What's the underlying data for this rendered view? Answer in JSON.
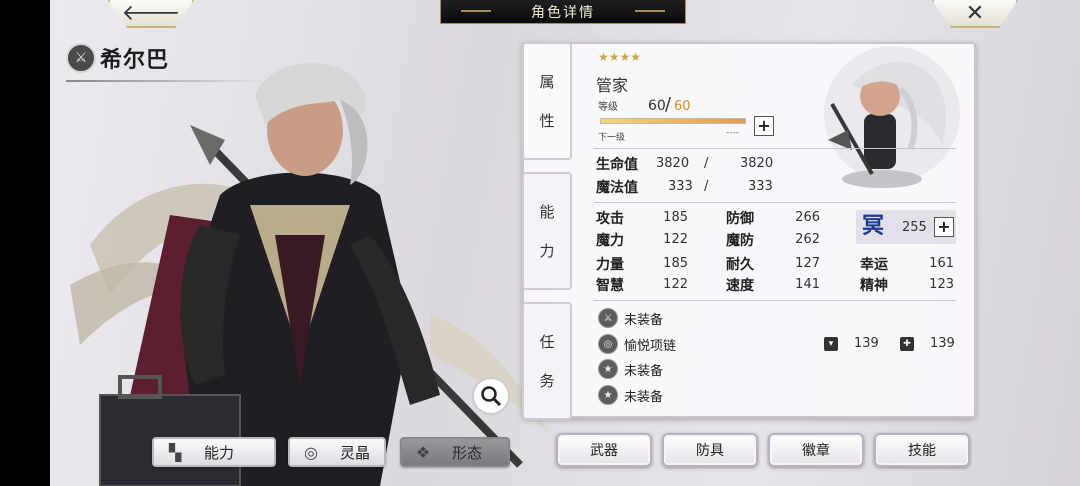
{
  "header": {
    "title": "角色详情",
    "back_icon": "arrow-left-icon",
    "close_icon": "close-icon"
  },
  "character": {
    "name": "希尔巴",
    "stars": "★★★★",
    "star_count": 4,
    "class": "管家"
  },
  "tabs": [
    {
      "label_1": "属",
      "label_2": "性"
    },
    {
      "label_1": "能",
      "label_2": "力"
    },
    {
      "label_1": "任",
      "label_2": "务"
    }
  ],
  "level": {
    "label": "等级",
    "current": "60",
    "slash": "/",
    "max": "60",
    "next_label": "下一级",
    "next_value": "----",
    "progress": 1.0
  },
  "vitals": {
    "hp_label": "生命值",
    "hp_current": "3820",
    "hp_max": "3820",
    "mp_label": "魔法值",
    "mp_current": "333",
    "mp_max": "333",
    "slash": "/"
  },
  "stats": {
    "atk_label": "攻击",
    "atk": "185",
    "def_label": "防御",
    "def": "266",
    "mag_label": "魔力",
    "mag": "122",
    "mdef_label": "魔防",
    "mdef": "262",
    "str_label": "力量",
    "str": "185",
    "end_label": "耐久",
    "end": "127",
    "luk_label": "幸运",
    "luk": "161",
    "int_label": "智慧",
    "int": "122",
    "spd_label": "速度",
    "spd": "141",
    "spi_label": "精神",
    "spi": "123"
  },
  "emblem": {
    "glyph": "冥",
    "value": "255"
  },
  "equipment": [
    {
      "label": "未装备"
    },
    {
      "label": "愉悦项链"
    },
    {
      "label": "未装备"
    },
    {
      "label": "未装备"
    }
  ],
  "equip_stats": {
    "stat_1": "139",
    "stat_2": "139"
  },
  "bottom_left": {
    "ability": "能力",
    "crystal": "灵晶",
    "form": "形态"
  },
  "bottom_right": {
    "weapon": "武器",
    "armor": "防具",
    "badge": "徽章",
    "skill": "技能"
  },
  "colors": {
    "accent_gold": "#c9a947",
    "level_max": "#d18b2a",
    "emblem_blue": "#1e3a8e"
  }
}
